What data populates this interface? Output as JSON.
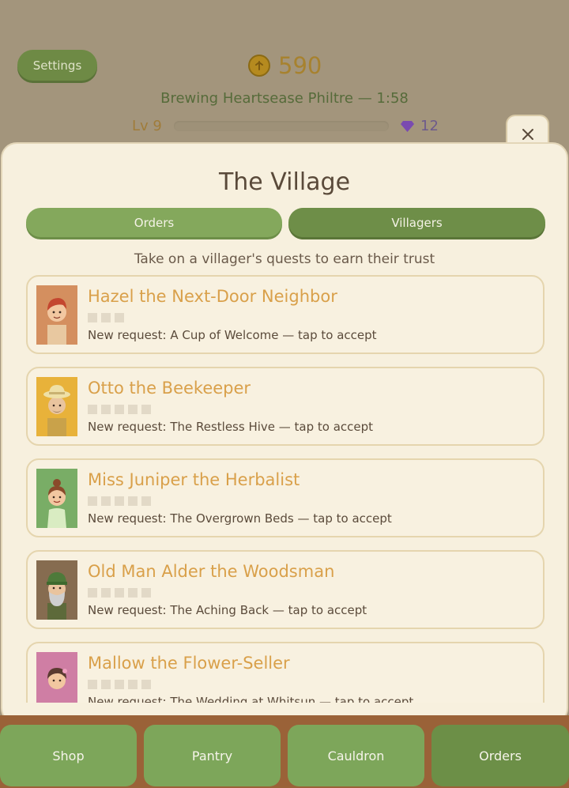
{
  "hud": {
    "settings_label": "Settings",
    "coins": "590",
    "brewing_status": "Brewing Heartsease Philtre — 1:58",
    "level": "Lv 9",
    "xp_progress": 0.0,
    "gems": "12"
  },
  "modal": {
    "close_label": "×",
    "title": "The Village",
    "tabs": [
      {
        "label": "Orders",
        "active": false
      },
      {
        "label": "Villagers",
        "active": true
      }
    ],
    "subtitle": "Take on a villager's quests to earn their trust",
    "villagers": [
      {
        "name": "Hazel the Next-Door Neighbor",
        "request": "New request: A Cup of Welcome — tap to accept",
        "trust_max": 3,
        "trust_level": 0,
        "portrait_bg": "#d48f5f"
      },
      {
        "name": "Otto the Beekeeper",
        "request": "New request: The Restless Hive — tap to accept",
        "trust_max": 5,
        "trust_level": 0,
        "portrait_bg": "#e8b23a"
      },
      {
        "name": "Miss Juniper the Herbalist",
        "request": "New request: The Overgrown Beds — tap to accept",
        "trust_max": 5,
        "trust_level": 0,
        "portrait_bg": "#79ad66"
      },
      {
        "name": "Old Man Alder the Woodsman",
        "request": "New request: The Aching Back — tap to accept",
        "trust_max": 5,
        "trust_level": 0,
        "portrait_bg": "#866c50"
      },
      {
        "name": "Mallow the Flower-Seller",
        "request": "New request: The Wedding at Whitsun — tap to accept",
        "trust_max": 5,
        "trust_level": 0,
        "portrait_bg": "#cf7ea4"
      }
    ]
  },
  "nav": [
    {
      "label": "Shop",
      "active": false
    },
    {
      "label": "Pantry",
      "active": false
    },
    {
      "label": "Cauldron",
      "active": false
    },
    {
      "label": "Orders",
      "active": true
    }
  ],
  "colors": {
    "accent_green": "#6e8e48",
    "villager_name": "#d9a04a",
    "modal_bg": "#f7f0de",
    "gem": "#7a4bb0"
  }
}
